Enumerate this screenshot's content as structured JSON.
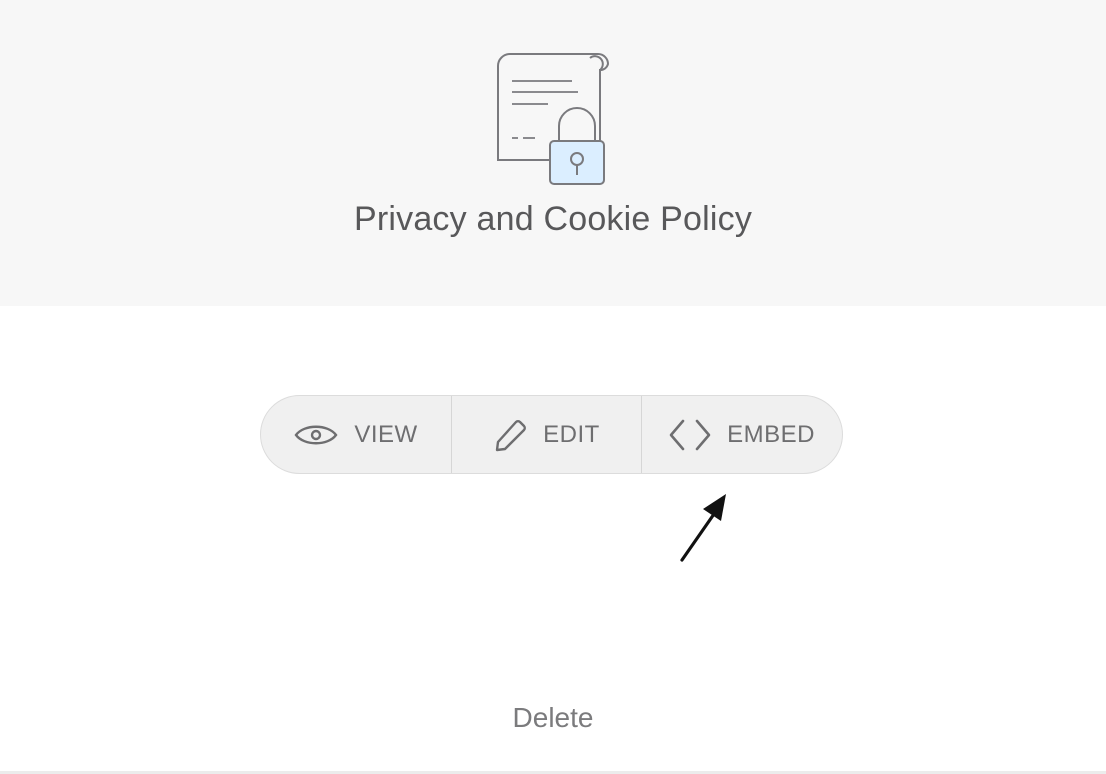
{
  "header": {
    "title": "Privacy and Cookie Policy",
    "icon": "document-lock-icon"
  },
  "actions": {
    "view_label": "VIEW",
    "view_icon": "eye-icon",
    "edit_label": "EDIT",
    "edit_icon": "pencil-icon",
    "embed_label": "EMBED",
    "embed_icon": "code-brackets-icon"
  },
  "footer": {
    "delete_label": "Delete"
  },
  "colors": {
    "header_bg": "#f7f7f7",
    "bar_bg": "#f0f0f0",
    "text": "#58585a",
    "lock_fill": "#dbeeff"
  }
}
